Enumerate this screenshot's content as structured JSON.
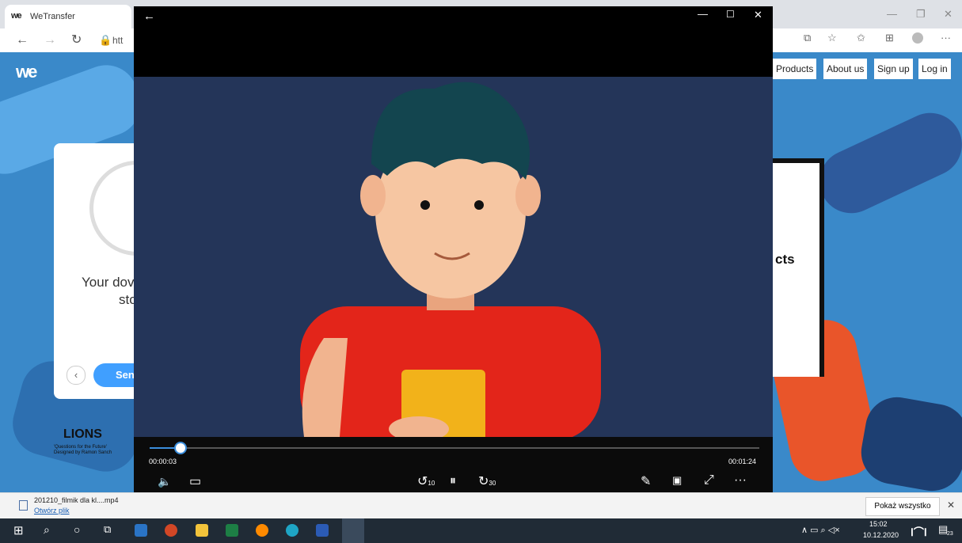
{
  "browser": {
    "tab_title": "WeTransfer",
    "tab_logo": "we",
    "url_text": "htt",
    "ext_icons": [
      "translate-icon",
      "star-icon",
      "favorites-icon",
      "collections-icon",
      "profile-icon",
      "more-icon"
    ]
  },
  "page": {
    "nav": [
      "Products",
      "About us",
      "Sign up",
      "Log in"
    ],
    "card_text_1": "Your dov",
    "card_text_2": "sto",
    "send_label": "Sen",
    "promo_text": "cts",
    "lions_text": "LIONS",
    "lions_sub1": "'Questions for the Future'",
    "lions_sub2": "Designed by Ramon Sanch"
  },
  "player": {
    "current_time": "00:00:03",
    "total_time": "00:01:24",
    "progress": 0.05,
    "skip_back": "10",
    "skip_forward": "30"
  },
  "download": {
    "filename": "201210_filmik dla kl....mp4",
    "open_link": "Otwórz plik",
    "show_all": "Pokaż wszystko"
  },
  "taskbar": {
    "time": "15:02",
    "date": "10.12.2020",
    "notif_count": "23"
  }
}
